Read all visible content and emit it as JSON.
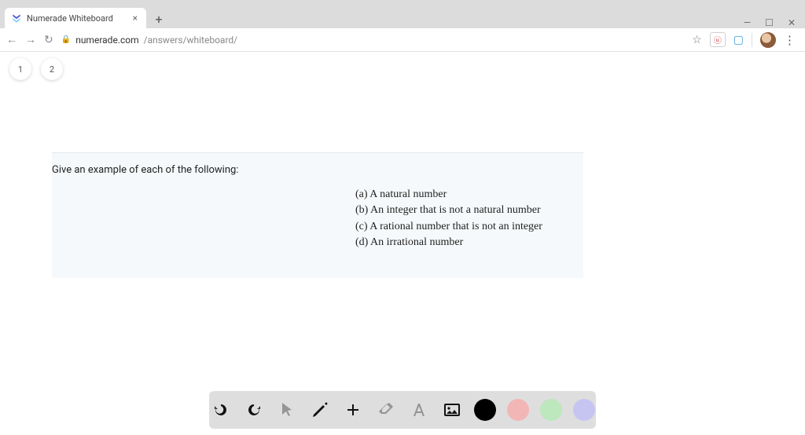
{
  "browser": {
    "tab_title": "Numerade Whiteboard",
    "url_host": "numerade.com",
    "url_path": "/answers/whiteboard/"
  },
  "pages": {
    "p1": "1",
    "p2": "2"
  },
  "slide": {
    "prompt": "Give an example of each of the following:",
    "a": "(a) A natural number",
    "b": "(b) An integer that is not a natural number",
    "c": "(c) A rational number that is not an integer",
    "d": "(d) An irrational number"
  },
  "tools": {
    "undo": "undo",
    "redo": "redo",
    "pointer": "pointer",
    "pen": "pen",
    "add": "add",
    "eraser": "eraser",
    "text": "text",
    "image": "image"
  },
  "colors": {
    "black": "#000000",
    "pink": "#f3b6b6",
    "green": "#bde7bd",
    "purple": "#c6c4f0"
  }
}
